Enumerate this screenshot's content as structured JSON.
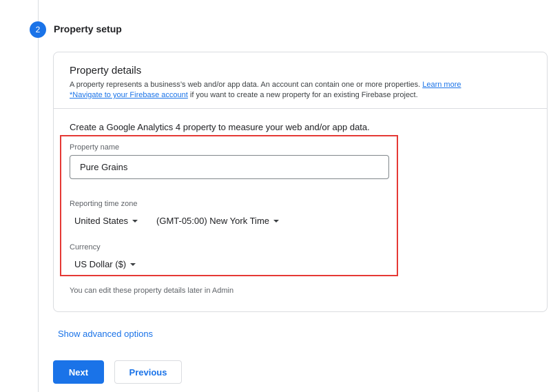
{
  "step": {
    "number": "2",
    "title": "Property setup"
  },
  "card": {
    "title": "Property details",
    "description_line1": "A property represents a business’s web and/or app data. An account can contain one or more properties.",
    "learn_more": "Learn more",
    "firebase_link": "*Navigate to your Firebase account",
    "description_line2_suffix": "if you want to create a new property for an existing Firebase project.",
    "create_text": "Create a Google Analytics 4 property to measure your web and/or app data.",
    "footnote": "You can edit these property details later in Admin"
  },
  "property_name": {
    "label": "Property name",
    "value": "Pure Grains"
  },
  "timezone": {
    "label": "Reporting time zone",
    "country": "United States",
    "zone": "(GMT-05:00) New York Time"
  },
  "currency": {
    "label": "Currency",
    "value": "US Dollar ($)"
  },
  "advanced_label": "Show advanced options",
  "buttons": {
    "next": "Next",
    "previous": "Previous"
  },
  "colors": {
    "accent": "#1a73e8",
    "highlight_border": "#e53935"
  }
}
